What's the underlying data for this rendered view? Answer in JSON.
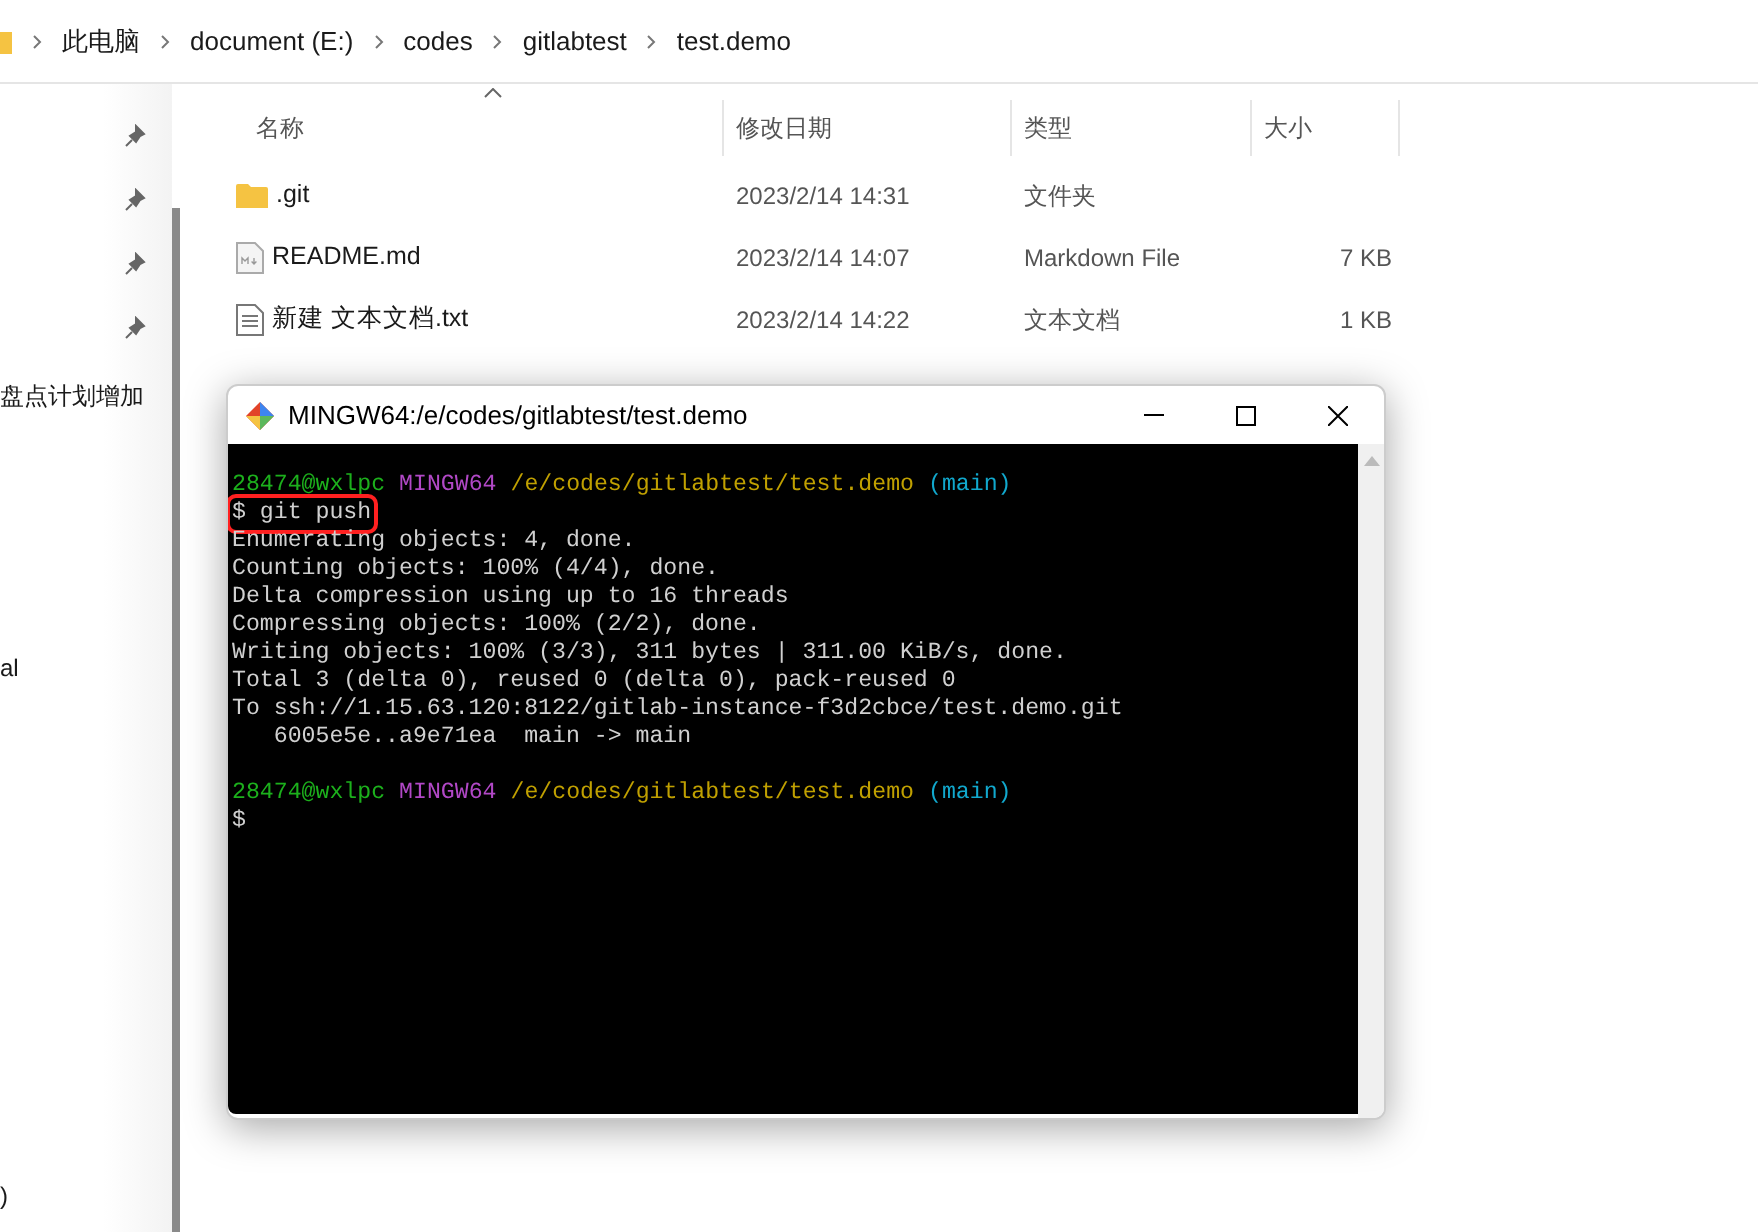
{
  "breadcrumb": [
    "此电脑",
    "document (E:)",
    "codes",
    "gitlabtest",
    "test.demo"
  ],
  "nav_items": [
    "盘点计划增加",
    "al",
    ")"
  ],
  "file_list": {
    "columns": [
      "名称",
      "修改日期",
      "类型",
      "大小"
    ],
    "rows": [
      {
        "kind": "folder",
        "name": ".git",
        "modified": "2023/2/14 14:31",
        "type": "文件夹"
      },
      {
        "kind": "markdown",
        "name": "README.md",
        "modified": "2023/2/14 14:07",
        "type": "Markdown File",
        "size": "7 KB"
      },
      {
        "kind": "text",
        "name": "新建 文本文档.txt",
        "modified": "2023/2/14 14:22",
        "type": "文本文档",
        "size": "1 KB"
      }
    ]
  },
  "terminal": {
    "title": "MINGW64:/e/codes/gitlabtest/test.demo",
    "lines": [
      {
        "highlighted": false,
        "segments": [
          {
            "kind": "user",
            "text": "28474@wxlpc"
          },
          {
            "kind": "host",
            "text": "MINGW64"
          },
          {
            "kind": "path",
            "text": "/e/codes/gitlabtest/test.demo"
          },
          {
            "kind": "branch",
            "text": "(main)"
          }
        ]
      },
      {
        "highlighted": true,
        "segments": [
          {
            "kind": "plain",
            "text": "$ git push"
          }
        ]
      },
      {
        "highlighted": false,
        "segments": [
          {
            "kind": "plain",
            "text": "Enumerating objects: 4, done."
          }
        ]
      },
      {
        "highlighted": false,
        "segments": [
          {
            "kind": "plain",
            "text": "Counting objects: 100% (4/4), done."
          }
        ]
      },
      {
        "highlighted": false,
        "segments": [
          {
            "kind": "plain",
            "text": "Delta compression using up to 16 threads"
          }
        ]
      },
      {
        "highlighted": false,
        "segments": [
          {
            "kind": "plain",
            "text": "Compressing objects: 100% (2/2), done."
          }
        ]
      },
      {
        "highlighted": false,
        "segments": [
          {
            "kind": "plain",
            "text": "Writing objects: 100% (3/3), 311 bytes | 311.00 KiB/s, done."
          }
        ]
      },
      {
        "highlighted": false,
        "segments": [
          {
            "kind": "plain",
            "text": "Total 3 (delta 0), reused 0 (delta 0), pack-reused 0"
          }
        ]
      },
      {
        "highlighted": false,
        "segments": [
          {
            "kind": "plain",
            "text": "To ssh://1.15.63.120:8122/gitlab-instance-f3d2cbce/test.demo.git"
          }
        ]
      },
      {
        "highlighted": false,
        "segments": [
          {
            "kind": "plain",
            "text": "   6005e5e..a9e71ea  main -> main"
          }
        ]
      },
      {
        "highlighted": false
      },
      {
        "highlighted": false,
        "segments": [
          {
            "kind": "user",
            "text": "28474@wxlpc"
          },
          {
            "kind": "host",
            "text": "MINGW64"
          },
          {
            "kind": "path",
            "text": "/e/codes/gitlabtest/test.demo"
          },
          {
            "kind": "branch",
            "text": "(main)"
          }
        ]
      },
      {
        "highlighted": false,
        "segments": [
          {
            "kind": "plain",
            "text": "$"
          }
        ]
      }
    ]
  }
}
